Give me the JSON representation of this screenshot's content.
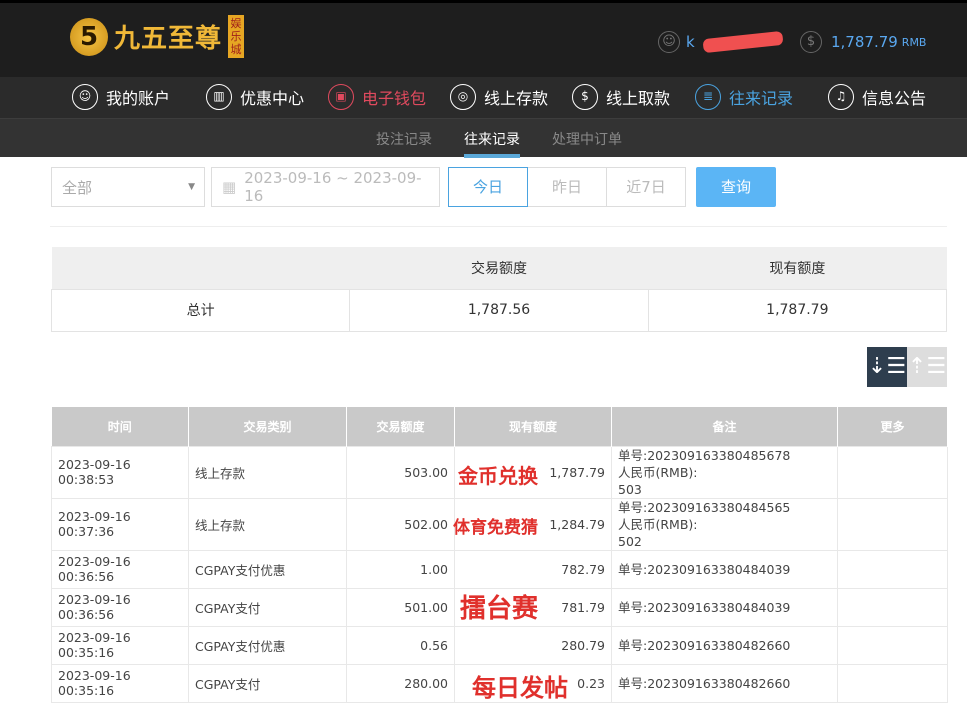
{
  "header": {
    "logo_mark": "5",
    "logo_text": "九五至尊",
    "logo_badge": "娱乐城",
    "user_initial": "k",
    "balance": "1,787.79",
    "currency": "RMB"
  },
  "nav": [
    {
      "label": "我的账户",
      "icon": "user-icon"
    },
    {
      "label": "优惠中心",
      "icon": "gift-icon"
    },
    {
      "label": "电子钱包",
      "icon": "wallet-icon"
    },
    {
      "label": "线上存款",
      "icon": "deposit-icon"
    },
    {
      "label": "线上取款",
      "icon": "withdraw-icon"
    },
    {
      "label": "往来记录",
      "icon": "records-icon"
    },
    {
      "label": "信息公告",
      "icon": "bell-icon"
    }
  ],
  "colors": {
    "active_nav": "#4aa3e0",
    "wallet_nav": "#e04a5e",
    "query": "#5bb5f5"
  },
  "subnav": [
    "投注记录",
    "往来记录",
    "处理中订单"
  ],
  "filter": {
    "type": "全部",
    "date_range": "2023-09-16 ~ 2023-09-16",
    "today": "今日",
    "yesterday": "昨日",
    "last7": "近7日",
    "query": "查询"
  },
  "summary": {
    "headers": [
      "",
      "交易额度",
      "现有额度"
    ],
    "row": [
      "总计",
      "1,787.56",
      "1,787.79"
    ]
  },
  "table": {
    "headers": [
      "时间",
      "交易类别",
      "交易额度",
      "现有额度",
      "备注",
      "更多"
    ],
    "rows": [
      {
        "time": "2023-09-16 00:38:53",
        "type": "线上存款",
        "amount": "503.00",
        "balance": "1,787.79",
        "note": [
          "单号:202309163380485678",
          "人民币(RMB):",
          "503"
        ]
      },
      {
        "time": "2023-09-16 00:37:36",
        "type": "线上存款",
        "amount": "502.00",
        "balance": "1,284.79",
        "note": [
          "单号:202309163380484565",
          "人民币(RMB):",
          "502"
        ]
      },
      {
        "time": "2023-09-16 00:36:56",
        "type": "CGPAY支付优惠",
        "amount": "1.00",
        "balance": "782.79",
        "note": [
          "单号:202309163380484039"
        ]
      },
      {
        "time": "2023-09-16 00:36:56",
        "type": "CGPAY支付",
        "amount": "501.00",
        "balance": "781.79",
        "note": [
          "单号:202309163380484039"
        ]
      },
      {
        "time": "2023-09-16 00:35:16",
        "type": "CGPAY支付优惠",
        "amount": "0.56",
        "balance": "280.79",
        "note": [
          "单号:202309163380482660"
        ]
      },
      {
        "time": "2023-09-16 00:35:16",
        "type": "CGPAY支付",
        "amount": "280.00",
        "balance": "0.23",
        "note": [
          "单号:202309163380482660"
        ]
      }
    ]
  },
  "overlays": [
    "金币兑换",
    "体育免费猜",
    "擂台赛",
    "每日发帖"
  ]
}
